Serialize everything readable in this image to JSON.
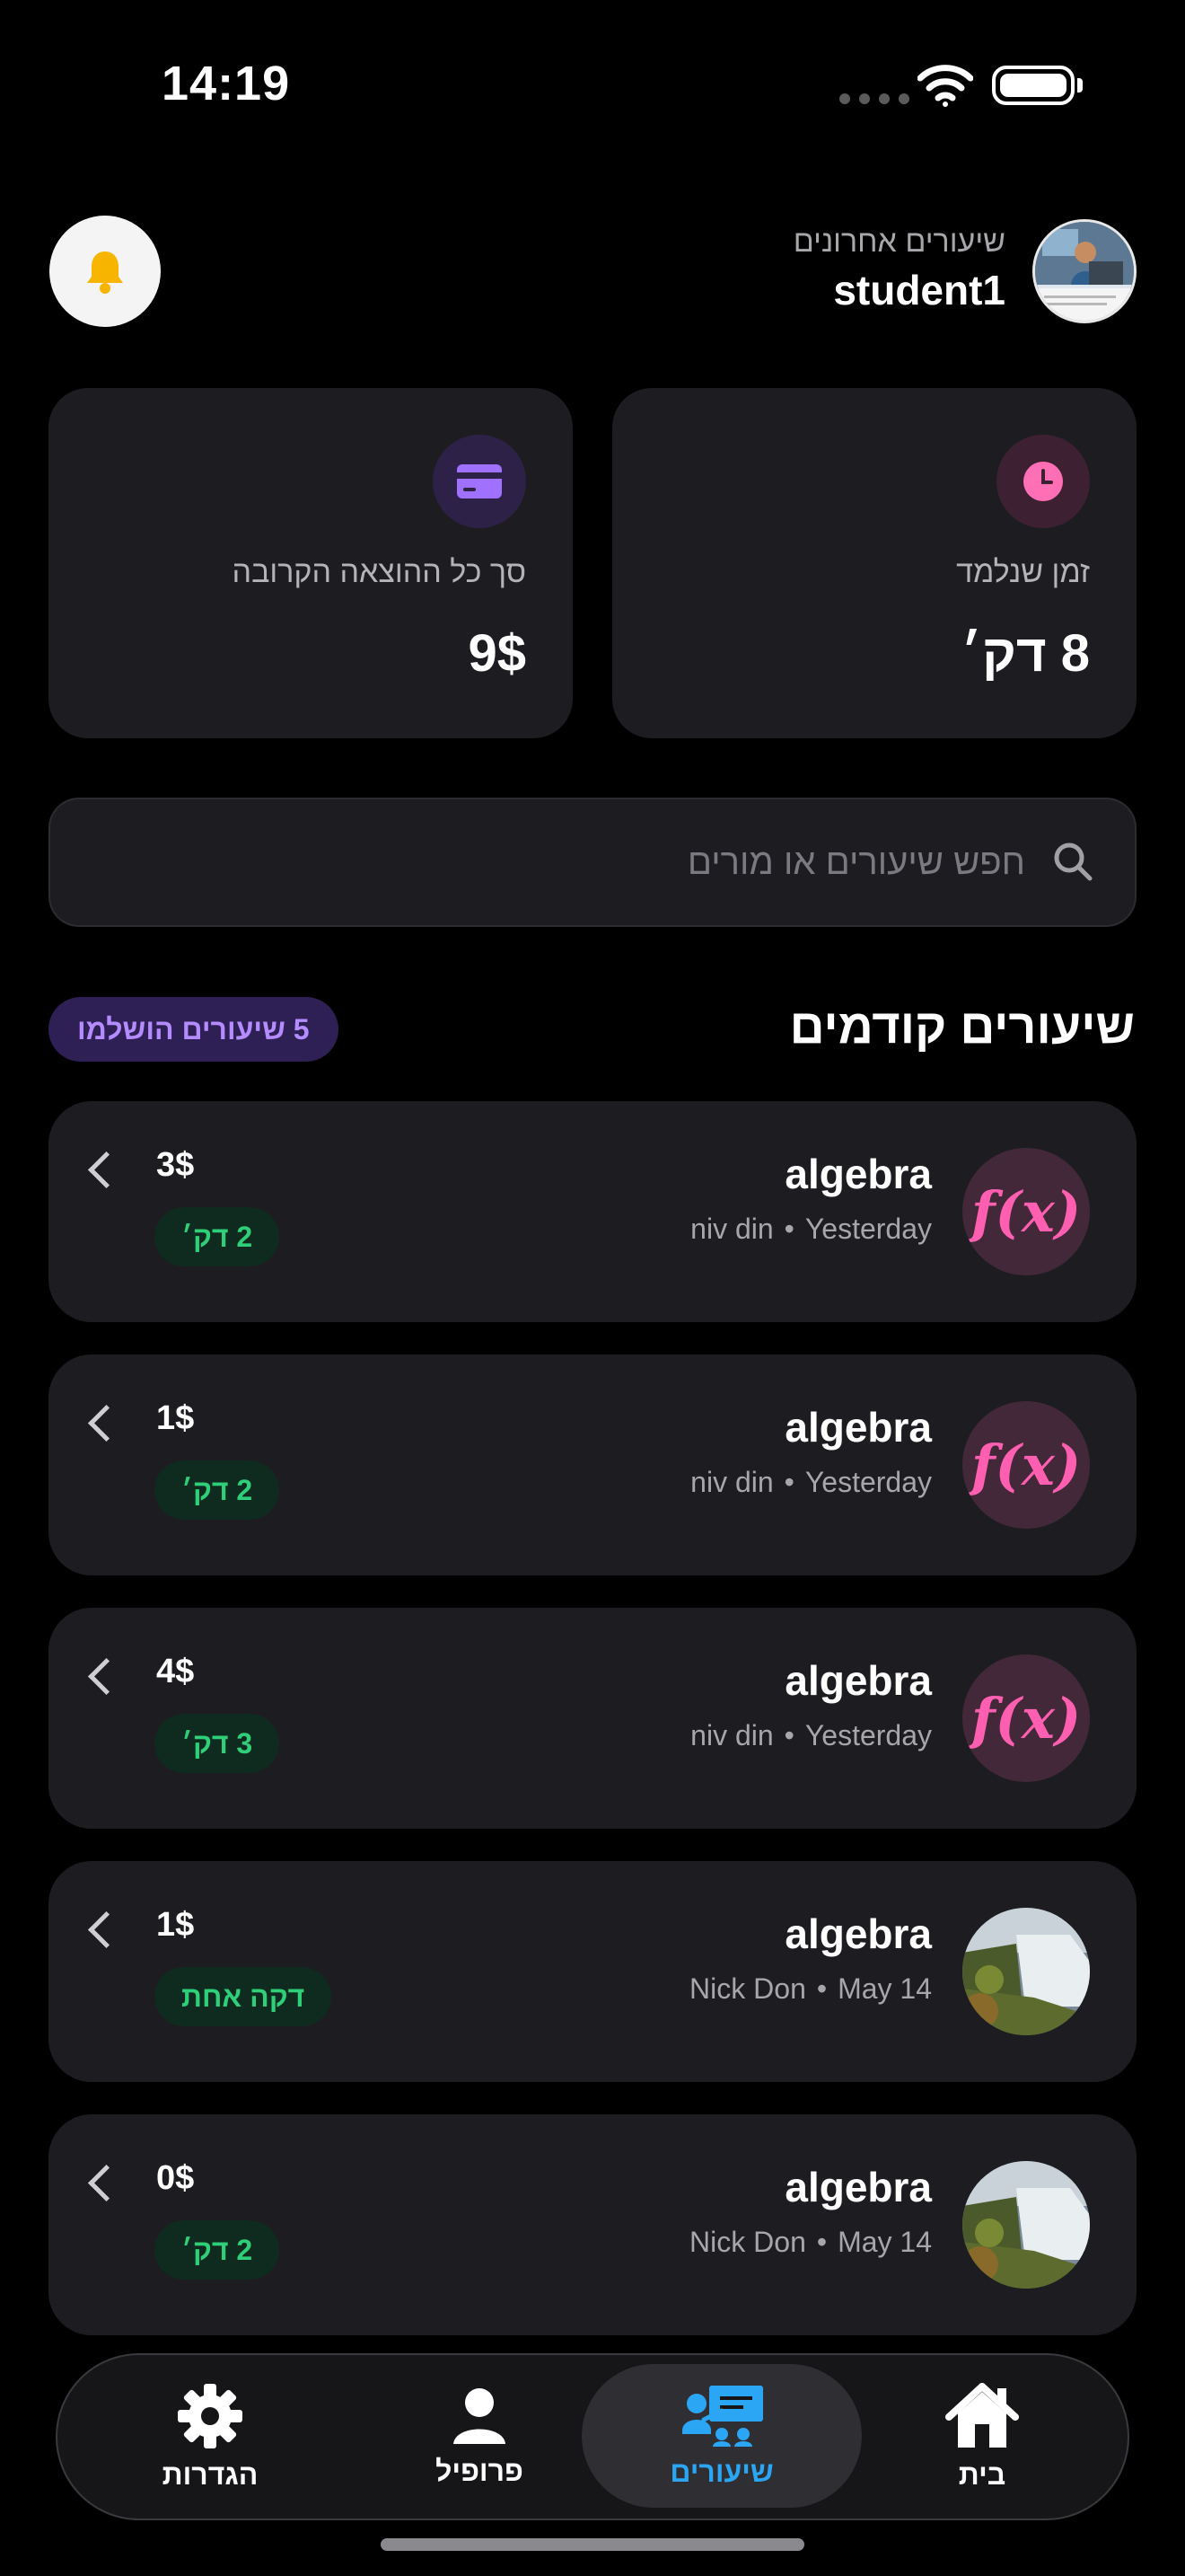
{
  "status_bar": {
    "time": "14:19"
  },
  "header": {
    "subtitle": "שיעורים אחרונים",
    "username": "student1"
  },
  "stats": {
    "time_learned": {
      "label": "זמן שנלמד",
      "value": "8 דק׳",
      "icon": "clock-icon",
      "color": "#ff6fb5"
    },
    "spending": {
      "label": "סך כל ההוצאה הקרובה",
      "value": "9$",
      "icon": "credit-card-icon",
      "color": "#a070ff"
    }
  },
  "search": {
    "placeholder": "חפש שיעורים או מורים"
  },
  "previous_lessons": {
    "title": "שיעורים קודמים",
    "badge": "5 שיעורים הושלמו",
    "items": [
      {
        "title": "algebra",
        "teacher": "niv din",
        "when": "Yesterday",
        "price": "3$",
        "duration": "2 דק׳",
        "avatar": "fx",
        "avatar_text": "ƒ(x)"
      },
      {
        "title": "algebra",
        "teacher": "niv din",
        "when": "Yesterday",
        "price": "1$",
        "duration": "2 דק׳",
        "avatar": "fx",
        "avatar_text": "ƒ(x)"
      },
      {
        "title": "algebra",
        "teacher": "niv din",
        "when": "Yesterday",
        "price": "4$",
        "duration": "3 דק׳",
        "avatar": "fx",
        "avatar_text": "ƒ(x)"
      },
      {
        "title": "algebra",
        "teacher": "Nick Don",
        "when": "May 14",
        "price": "1$",
        "duration": "דקה אחת",
        "avatar": "waterfall-photo"
      },
      {
        "title": "algebra",
        "teacher": "Nick Don",
        "when": "May 14",
        "price": "0$",
        "duration": "2 דק׳",
        "avatar": "waterfall-photo"
      }
    ]
  },
  "tabs": [
    {
      "label": "הגדרות",
      "icon": "gear-icon",
      "active": false
    },
    {
      "label": "פרופיל",
      "icon": "person-icon",
      "active": false
    },
    {
      "label": "שיעורים",
      "icon": "teacher-board-icon",
      "active": true,
      "color": "#2aa6f5"
    },
    {
      "label": "בית",
      "icon": "home-icon",
      "active": false
    }
  ]
}
